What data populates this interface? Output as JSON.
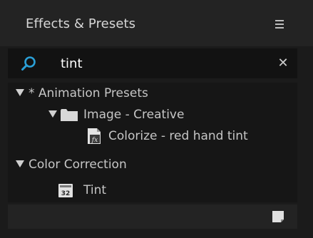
{
  "panel": {
    "title": "Effects & Presets",
    "menu_icon": "hamburger-menu-icon"
  },
  "search": {
    "value": "tint",
    "search_icon": "search-icon",
    "clear_icon": "close-icon",
    "clear_glyph": "✕"
  },
  "tree": {
    "animation_presets": "* Animation Presets",
    "image_creative": "Image - Creative",
    "colorize": "Colorize - red hand tint",
    "color_correction": "Color Correction",
    "tint": "Tint"
  },
  "icons": {
    "folder": "folder-icon",
    "preset": "animation-preset-icon",
    "effect": "effect-32bit-icon",
    "effect_badge": "32",
    "new_item": "new-item-icon"
  },
  "colors": {
    "accent": "#2a9fd6",
    "panel_bg": "#1b1b1b",
    "header_bg": "#232323",
    "list_bg": "#161616",
    "text": "#c6c6c6"
  }
}
